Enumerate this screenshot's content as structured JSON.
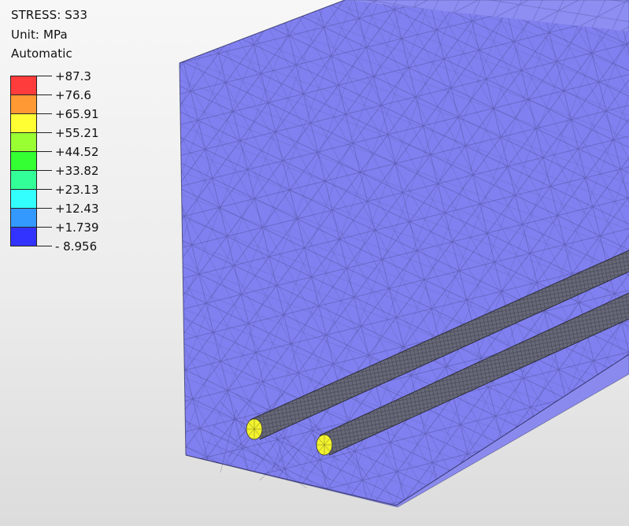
{
  "legend": {
    "title": "STRESS: S33",
    "unit": "Unit: MPa",
    "mode": "Automatic",
    "colors": [
      "#ff3c3c",
      "#ff9933",
      "#ffff33",
      "#99ff33",
      "#33ff33",
      "#33ff99",
      "#33ffff",
      "#3399ff",
      "#3333ff"
    ],
    "labels": [
      "+87.3",
      "+76.6",
      "+65.91",
      "+55.21",
      "+44.52",
      "+33.82",
      "+23.13",
      "+12.43",
      "+1.739",
      "- 8.956"
    ]
  },
  "model": {
    "body_color": "#8080f0",
    "rebar_color": "#6b6d7e",
    "rebar_end_color": "#f2f22e"
  }
}
